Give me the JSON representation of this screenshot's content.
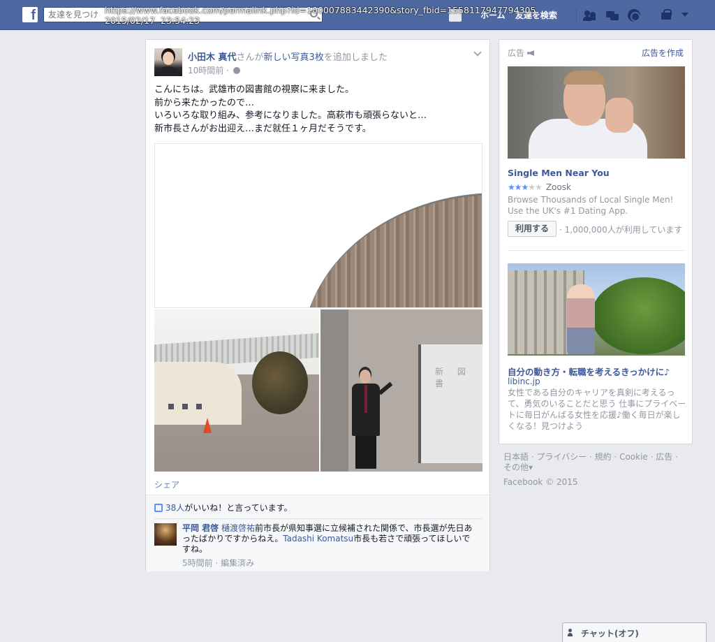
{
  "browser": {
    "url_line": "https://www.facebook.com/permalink.php?id=100007883442390&story_fbid=1558117947794305",
    "timestamp_line": "2015/02/17  23:54:23"
  },
  "topbar": {
    "logo": "f",
    "search_placeholder": "友達を見つけ",
    "nav_home": "ホーム",
    "nav_find_friends": "友達を検索",
    "icons": [
      "friend-requests-icon",
      "messages-icon",
      "notifications-icon",
      "privacy-icon",
      "account-caret-icon"
    ]
  },
  "post": {
    "author": "小田木 真代",
    "action_prefix": "さんが",
    "action_link": "新しい写真3枚",
    "action_suffix": "を追加しました",
    "time": "10時間前 · ",
    "body": "こんにちは。武雄市の図書館の視察に来ました。\n前から来たかったので…\nいろいろな取り組み、参考になりました。高萩市も頑張らないと…\n新市長さんがお出迎え…まだ就任１ヶ月だそうです。",
    "screen_text": "新 図 書",
    "share_label": "シェア",
    "likes_link": "38人",
    "likes_suffix": "がいいね！と言っています。",
    "comment": {
      "author": "平岡 君啓",
      "mention": "樋渡啓祐",
      "text_1": "前市長が県知事選に立候補された関係で、市長選が先日あったばかりですからねえ。",
      "mention_2": "Tadashi Komatsu",
      "text_2": "市長も若さで頑張ってほしいですね。",
      "meta": "5時間前 · 編集済み"
    }
  },
  "ads": {
    "header": "広告",
    "create_link": "広告を作成",
    "ad1": {
      "title": "Single Men Near You",
      "rating_stars": 3,
      "rating_max": 5,
      "source": "Zoosk",
      "desc": "Browse Thousands of Local Single Men! Use the UK's #1 Dating App.",
      "cta": "利用する",
      "users": "· 1,000,000人が利用しています"
    },
    "ad2": {
      "title": "自分の動き方・転職を考えるきっかけに♪",
      "source": "libinc.jp",
      "desc": "女性である自分のキャリアを真剣に考えるって、勇気のいることだと思う 仕事にプライベートに毎日がんばる女性を応援♪働く毎日が楽しくなる！見つけよう"
    }
  },
  "footer": {
    "links": "日本語 · プライバシー · 規約 · Cookie · 広告 · その他▾",
    "copyright": "Facebook © 2015"
  },
  "chat": {
    "label": "チャット(オフ)"
  },
  "colors": {
    "topbar": "#4e69a2",
    "link": "#3b5998",
    "page_bg": "#e9eaed"
  }
}
